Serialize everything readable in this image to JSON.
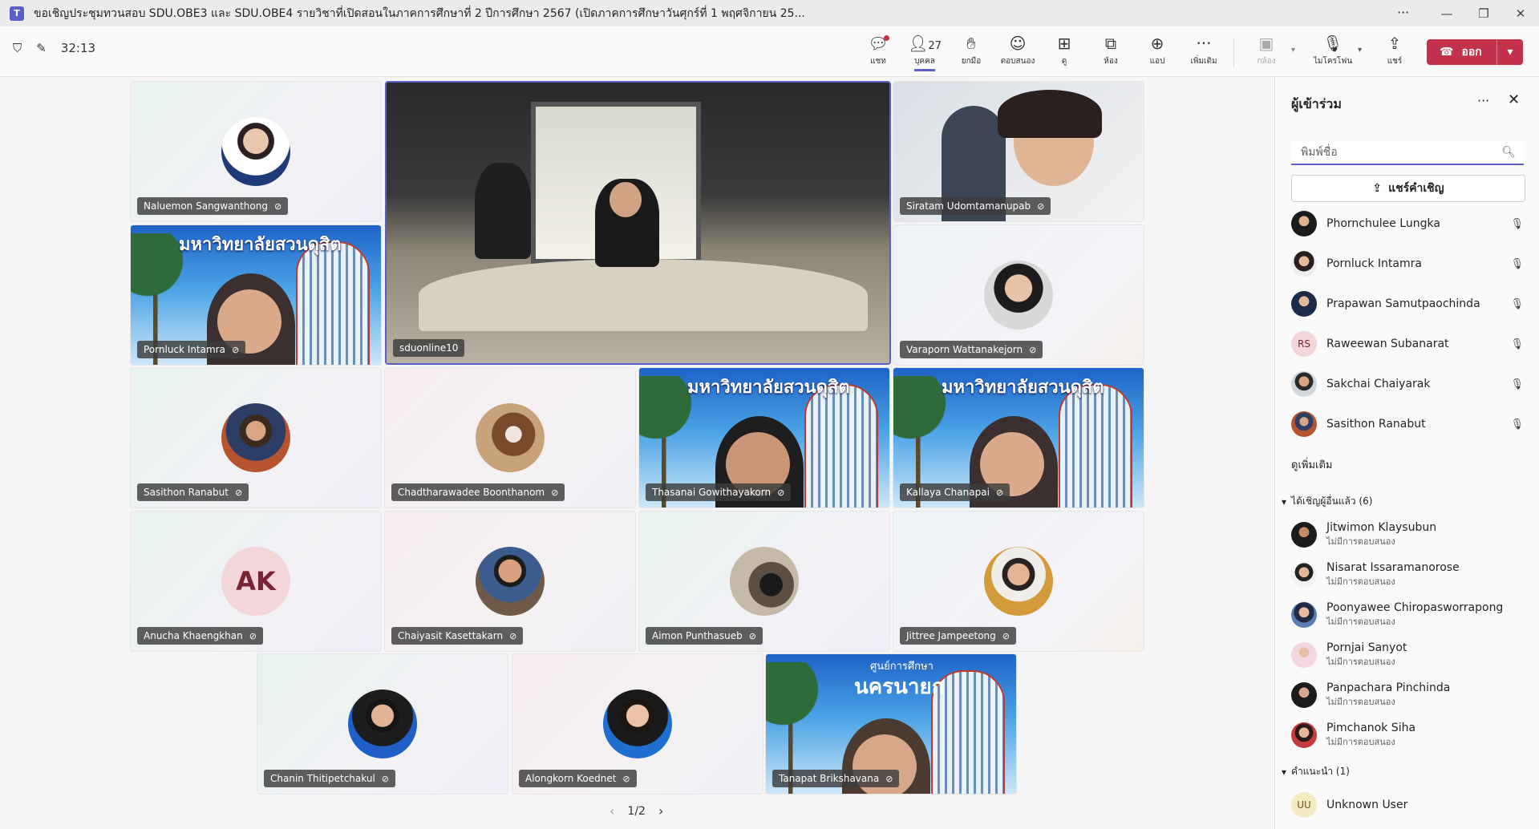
{
  "window": {
    "title": "ขอเชิญประชุมทวนสอบ SDU.OBE3 และ SDU.OBE4 รายวิชาที่เปิดสอนในภาคการศึกษาที่ 2 ปีการศึกษา 2567 (เปิดภาคการศึกษาวันศุกร์ที่ 1 พฤศจิกายน 25...",
    "more": "···"
  },
  "toolbar": {
    "timer": "32:13",
    "chat_label": "แชท",
    "people_count": "27",
    "people_label": "บุคคล",
    "raise_label": "ยกมือ",
    "react_label": "ตอบสนอง",
    "view_label": "ดู",
    "rooms_label": "ห้อง",
    "apps_label": "แอป",
    "more_label": "เพิ่มเติม",
    "camera_label": "กล้อง",
    "mic_label": "ไมโครโฟน",
    "share_label": "แชร์",
    "leave_label": "ออก"
  },
  "tiles": [
    {
      "name": "Naluemon Sangwanthong"
    },
    {
      "name": "sduonline10"
    },
    {
      "name": "Siratam Udomtamanupab"
    },
    {
      "name": "Pornluck Intamra"
    },
    {
      "name": "Varaporn Wattanakejorn"
    },
    {
      "name": "Sasithon Ranabut"
    },
    {
      "name": "Chadtharawadee Boonthanom"
    },
    {
      "name": "Thasanai Gowithayakorn"
    },
    {
      "name": "Kallaya Chanapai"
    },
    {
      "name": "Anucha Khaengkhan",
      "initials": "AK"
    },
    {
      "name": "Chaiyasit Kasettakarn"
    },
    {
      "name": "Aimon Punthasueb"
    },
    {
      "name": "Jittree Jampeetong"
    },
    {
      "name": "Chanin Thitipetchakul"
    },
    {
      "name": "Alongkorn Koednet"
    },
    {
      "name": "Tanapat Brikshavana"
    }
  ],
  "banner": {
    "university": "มหาวิทยาลัยสวนดุสิต",
    "center_line1": "ศูนย์การศึกษา",
    "center_line2": "นครนายก"
  },
  "pager": {
    "page": "1/2"
  },
  "panel": {
    "title": "ผู้เข้าร่วม",
    "search_placeholder": "พิมพ์ชื่อ",
    "invite_label": "แชร์คำเชิญ",
    "participants": [
      {
        "name": "Phornchulee Lungka"
      },
      {
        "name": "Pornluck Intamra"
      },
      {
        "name": "Prapawan Samutpaochinda"
      },
      {
        "name": "Raweewan Subanarat",
        "initials": "RS"
      },
      {
        "name": "Sakchai Chaiyarak"
      },
      {
        "name": "Sasithon Ranabut"
      }
    ],
    "see_more": "ดูเพิ่มเติม",
    "invited_header": "ได้เชิญผู้อื่นแล้ว (6)",
    "invited": [
      {
        "name": "Jitwimon Klaysubun",
        "status": "ไม่มีการตอบสนอง"
      },
      {
        "name": "Nisarat Issaramanorose",
        "status": "ไม่มีการตอบสนอง"
      },
      {
        "name": "Poonyawee Chiropasworrapong",
        "status": "ไม่มีการตอบสนอง"
      },
      {
        "name": "Pornjai Sanyot",
        "status": "ไม่มีการตอบสนอง"
      },
      {
        "name": "Panpachara Pinchinda",
        "status": "ไม่มีการตอบสนอง"
      },
      {
        "name": "Pimchanok Siha",
        "status": "ไม่มีการตอบสนอง"
      }
    ],
    "suggested_header": "คำแนะนำ (1)",
    "suggested": [
      {
        "name": "Unknown User",
        "initials": "UU"
      }
    ]
  },
  "colors": {
    "accent": "#5b5fc7",
    "leave": "#c4314b"
  }
}
